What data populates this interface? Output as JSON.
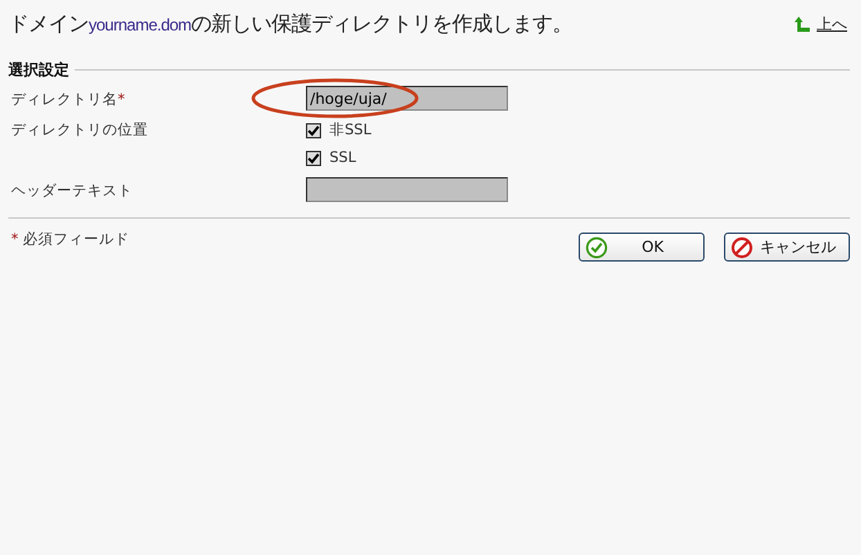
{
  "title": {
    "before": "ドメイン",
    "domain": "yourname.dom",
    "after": "の新しい保護ディレクトリを作成します。"
  },
  "up_link": "上へ",
  "section": "選択設定",
  "fields": [
    {
      "kind": "text",
      "label": "ディレクトリ名",
      "required": true,
      "value": "/hoge/uja/"
    },
    {
      "kind": "checks",
      "label": "ディレクトリの位置",
      "options": [
        {
          "label": "非SSL",
          "checked": true
        },
        {
          "label": "SSL",
          "checked": true
        }
      ]
    },
    {
      "kind": "text",
      "label": "ヘッダーテキスト"
    }
  ],
  "required_mark": "*",
  "required_legend_mark": "*",
  "required_note": "必須フィールド",
  "buttons": [
    {
      "kind": "ok",
      "label": "OK"
    },
    {
      "kind": "cancel",
      "label": "キャンセル"
    }
  ],
  "annotation": {
    "kind": "ellipse",
    "color": "#c8401e"
  }
}
